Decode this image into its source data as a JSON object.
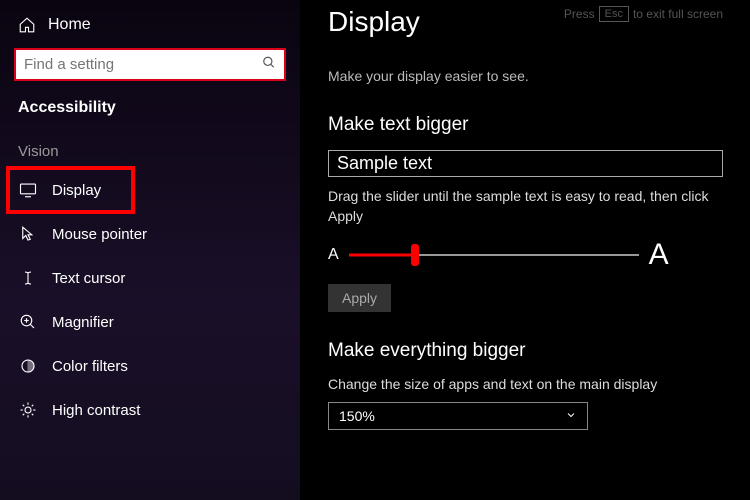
{
  "sidebar": {
    "home": "Home",
    "searchPlaceholder": "Find a setting",
    "sectionTitle": "Accessibility",
    "groupLabel": "Vision",
    "items": [
      {
        "label": "Display"
      },
      {
        "label": "Mouse pointer"
      },
      {
        "label": "Text cursor"
      },
      {
        "label": "Magnifier"
      },
      {
        "label": "Color filters"
      },
      {
        "label": "High contrast"
      }
    ]
  },
  "main": {
    "title": "Display",
    "escHint": {
      "pre": "Press",
      "key": "Esc",
      "post": "to exit full screen"
    },
    "subtitle": "Make your display easier to see.",
    "textBigger": {
      "heading": "Make text bigger",
      "sample": "Sample text",
      "instruction": "Drag the slider until the sample text is easy to read, then click Apply",
      "smallA": "A",
      "bigA": "A",
      "apply": "Apply"
    },
    "everythingBigger": {
      "heading": "Make everything bigger",
      "desc": "Change the size of apps and text on the main display",
      "selected": "150%"
    }
  }
}
